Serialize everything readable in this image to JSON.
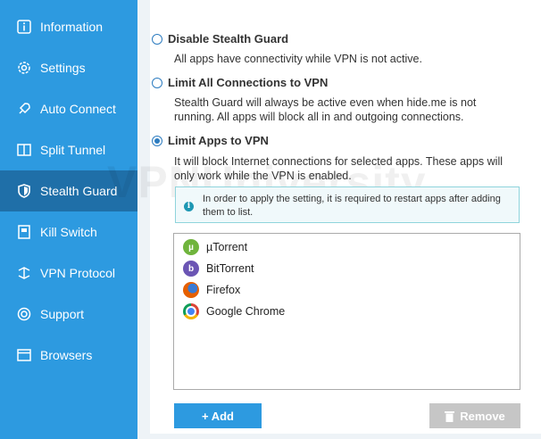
{
  "sidebar": {
    "items": [
      {
        "label": "Information",
        "icon": "info-icon"
      },
      {
        "label": "Settings",
        "icon": "gear-icon"
      },
      {
        "label": "Auto Connect",
        "icon": "rocket-icon"
      },
      {
        "label": "Split Tunnel",
        "icon": "split-icon"
      },
      {
        "label": "Stealth Guard",
        "icon": "shield-icon"
      },
      {
        "label": "Kill Switch",
        "icon": "kill-switch-icon"
      },
      {
        "label": "VPN Protocol",
        "icon": "protocol-icon"
      },
      {
        "label": "Support",
        "icon": "lifebuoy-icon"
      },
      {
        "label": "Browsers",
        "icon": "browser-icon"
      }
    ],
    "active_index": 4
  },
  "options": [
    {
      "title": "Disable Stealth Guard",
      "desc": "All apps have connectivity while VPN is not active.",
      "checked": false
    },
    {
      "title": "Limit All Connections to VPN",
      "desc": "Stealth Guard will always be active even when hide.me is not running. All apps will block all in and outgoing connections.",
      "checked": false
    },
    {
      "title": "Limit Apps to VPN",
      "desc": "It will block Internet connections for selected apps. These apps will only work while the VPN is enabled.",
      "checked": true
    }
  ],
  "info": {
    "text": "In order to apply the setting, it is required to restart apps after adding them to list."
  },
  "apps": [
    {
      "name": "µTorrent",
      "icon": "utorrent-icon",
      "color": "#6fb43c"
    },
    {
      "name": "BitTorrent",
      "icon": "bittorrent-icon",
      "color": "#6b55b4"
    },
    {
      "name": "Firefox",
      "icon": "firefox-icon",
      "color": "#e66000"
    },
    {
      "name": "Google Chrome",
      "icon": "chrome-icon",
      "color": "#db4437"
    }
  ],
  "buttons": {
    "add": "+ Add",
    "remove": "Remove"
  },
  "watermark": "VPNUniversity",
  "colors": {
    "sidebar": "#2d9ae0",
    "sidebar_active": "#1f6fa8",
    "radio": "#2d7cc0"
  }
}
